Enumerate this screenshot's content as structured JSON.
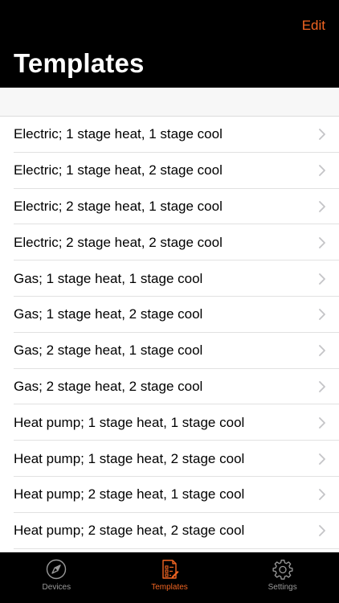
{
  "header": {
    "edit_label": "Edit",
    "title": "Templates"
  },
  "templates": [
    {
      "label": "Electric; 1 stage heat, 1 stage cool"
    },
    {
      "label": "Electric; 1 stage heat, 2 stage cool"
    },
    {
      "label": "Electric; 2 stage heat, 1 stage cool"
    },
    {
      "label": "Electric; 2 stage heat, 2 stage cool"
    },
    {
      "label": "Gas; 1 stage heat, 1 stage cool"
    },
    {
      "label": "Gas; 1 stage heat, 2 stage cool"
    },
    {
      "label": "Gas; 2 stage heat, 1 stage cool"
    },
    {
      "label": "Gas; 2 stage heat, 2 stage cool"
    },
    {
      "label": "Heat pump; 1 stage heat, 1 stage cool"
    },
    {
      "label": "Heat pump; 1 stage heat, 2 stage cool"
    },
    {
      "label": "Heat pump; 2 stage heat, 1 stage cool"
    },
    {
      "label": "Heat pump; 2 stage heat, 2 stage cool"
    }
  ],
  "tab_bar": {
    "tabs": [
      {
        "label": "Devices",
        "icon": "compass-icon"
      },
      {
        "label": "Templates",
        "icon": "template-document-icon"
      },
      {
        "label": "Settings",
        "icon": "gear-icon"
      }
    ],
    "active_tab": "Templates"
  },
  "colors": {
    "accent": "#f26522",
    "header_bg": "#000000",
    "tab_inactive": "#9a9a9a"
  }
}
